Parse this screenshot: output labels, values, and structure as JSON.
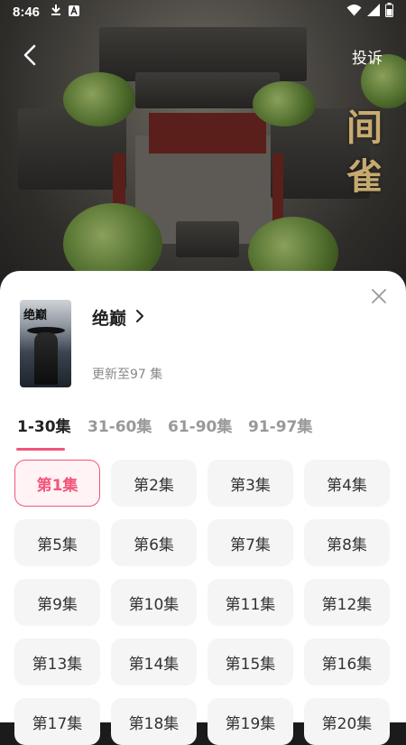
{
  "status_bar": {
    "time": "8:46"
  },
  "video": {
    "report_label": "投诉",
    "calligraphy": "间 雀"
  },
  "drama": {
    "poster_title": "绝巅",
    "title": "绝巅",
    "update_text": "更新至97 集"
  },
  "tabs": [
    {
      "label": "1-30集",
      "active": true
    },
    {
      "label": "31-60集",
      "active": false
    },
    {
      "label": "61-90集",
      "active": false
    },
    {
      "label": "91-97集",
      "active": false
    }
  ],
  "episodes": [
    "第1集",
    "第2集",
    "第3集",
    "第4集",
    "第5集",
    "第6集",
    "第7集",
    "第8集",
    "第9集",
    "第10集",
    "第11集",
    "第12集",
    "第13集",
    "第14集",
    "第15集",
    "第16集",
    "第17集",
    "第18集",
    "第19集",
    "第20集"
  ],
  "selected_episode": "第1集",
  "colors": {
    "accent": "#f2557a",
    "tile_bg": "#f5f5f5",
    "selected_bg": "#fff3f5"
  },
  "icons": [
    "download-icon",
    "a-icon",
    "wifi-icon",
    "signal-icon",
    "battery-icon",
    "back-arrow-icon",
    "close-icon",
    "chevron-right-icon"
  ]
}
